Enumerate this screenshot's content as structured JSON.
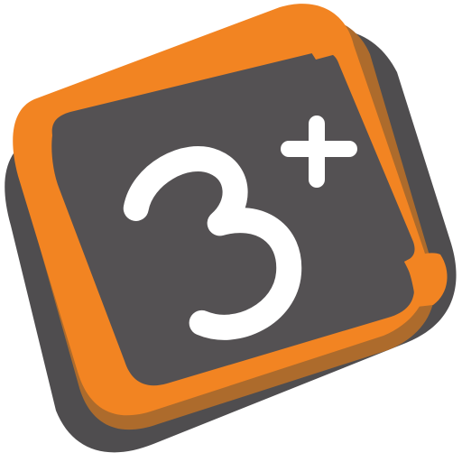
{
  "icon": {
    "name": "3+ app icon",
    "symbol": "3",
    "superscript": "+",
    "colors": {
      "background": "#ffffff",
      "base_shadow": "#4f4d4f",
      "frame_orange": "#f28422",
      "frame_orange_shadow": "#ad6b2c",
      "inner_dark": "#545153",
      "glyph_white": "#ffffff"
    }
  }
}
